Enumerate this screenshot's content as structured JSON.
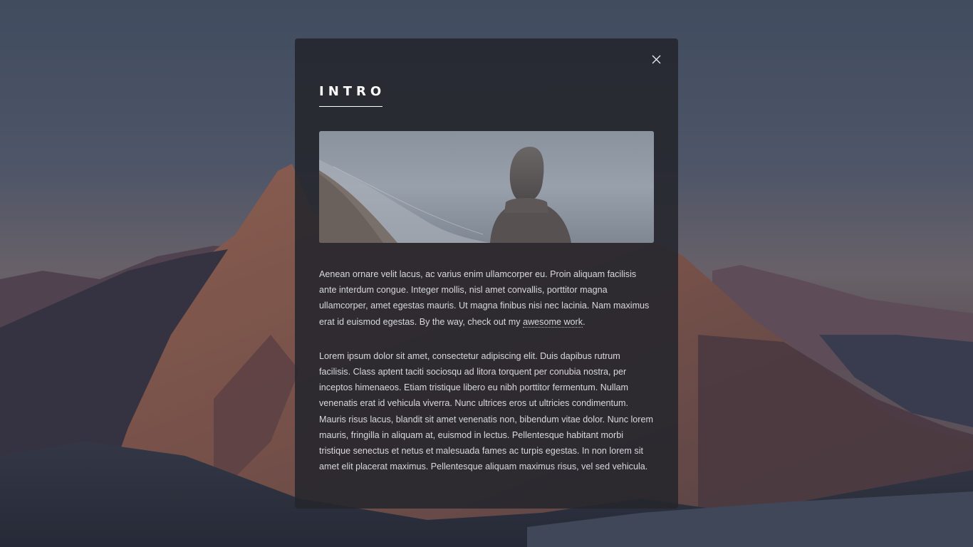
{
  "modal": {
    "title": "INTRO",
    "close_icon": "close-icon",
    "hero_image": "hooded-figure-on-beach-image",
    "paragraphs": [
      {
        "before_link": "Aenean ornare velit lacus, ac varius enim ullamcorper eu. Proin aliquam facilisis ante interdum congue. Integer mollis, nisl amet convallis, porttitor magna ullamcorper, amet egestas mauris. Ut magna finibus nisi nec lacinia. Nam maximus erat id euismod egestas. By the way, check out my ",
        "link_text": "awesome work",
        "after_link": "."
      },
      {
        "text": "Lorem ipsum dolor sit amet, consectetur adipiscing elit. Duis dapibus rutrum facilisis. Class aptent taciti sociosqu ad litora torquent per conubia nostra, per inceptos himenaeos. Etiam tristique libero eu nibh porttitor fermentum. Nullam venenatis erat id vehicula viverra. Nunc ultrices eros ut ultricies condimentum. Mauris risus lacus, blandit sit amet venenatis non, bibendum vitae dolor. Nunc lorem mauris, fringilla in aliquam at, euismod in lectus. Pellentesque habitant morbi tristique senectus et netus et malesuada fames ac turpis egestas. In non lorem sit amet elit placerat maximus. Pellentesque aliquam maximus risus, vel sed vehicula."
      }
    ]
  },
  "background": {
    "image": "mountain-landscape-background"
  },
  "colors": {
    "modal_bg": "#24262c",
    "text": "#d7d9de",
    "title": "#ffffff"
  }
}
